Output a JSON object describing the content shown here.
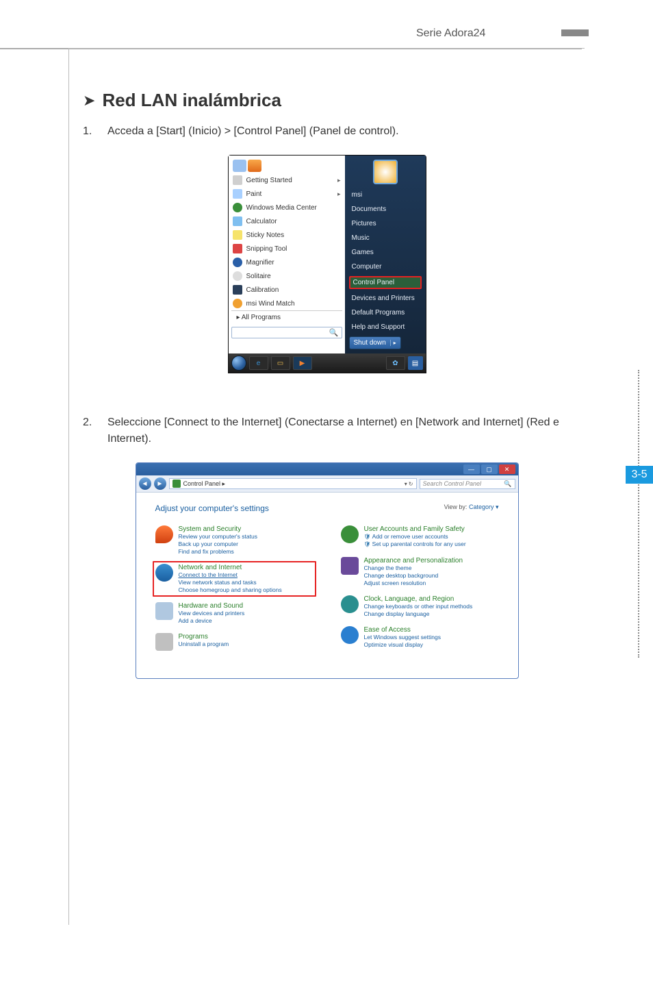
{
  "header": {
    "title": "Serie Adora24"
  },
  "section": {
    "heading": "Red LAN inalámbrica"
  },
  "steps": {
    "s1_num": "1.",
    "s1_text": "Acceda a [Start] (Inicio) > [Control Panel] (Panel de control).",
    "s2_num": "2.",
    "s2_text": "Seleccione [Connect to the Internet] (Conectarse a Internet) en [Network and Internet] (Red e Internet)."
  },
  "startmenu": {
    "programs": {
      "getting_started": "Getting Started",
      "paint": "Paint",
      "wmc": "Windows Media Center",
      "calculator": "Calculator",
      "sticky": "Sticky Notes",
      "snip": "Snipping Tool",
      "magnifier": "Magnifier",
      "solitaire": "Solitaire",
      "calibration": "Calibration",
      "windmatch": "msi Wind Match",
      "allprograms": "All Programs"
    },
    "right": {
      "user": "msi",
      "documents": "Documents",
      "pictures": "Pictures",
      "music": "Music",
      "games": "Games",
      "computer": "Computer",
      "controlpanel": "Control Panel",
      "devices": "Devices and Printers",
      "defaultprog": "Default Programs",
      "help": "Help and Support",
      "shutdown": "Shut down"
    },
    "search_placeholder": ""
  },
  "cpwin": {
    "titlebar": {
      "min": "—",
      "max": "▢",
      "close": "✕"
    },
    "breadcrumb": "Control Panel  ▸",
    "search_placeholder": "Search Control Panel",
    "heading": "Adjust your computer's settings",
    "viewby_label": "View by:",
    "viewby_value": "Category ▾",
    "left": {
      "sys": {
        "title": "System and Security",
        "l1": "Review your computer's status",
        "l2": "Back up your computer",
        "l3": "Find and fix problems"
      },
      "net": {
        "title": "Network and Internet",
        "l1": "Connect to the Internet",
        "l2": "View network status and tasks",
        "l3": "Choose homegroup and sharing options"
      },
      "hw": {
        "title": "Hardware and Sound",
        "l1": "View devices and printers",
        "l2": "Add a device"
      },
      "prog": {
        "title": "Programs",
        "l1": "Uninstall a program"
      }
    },
    "right": {
      "user": {
        "title": "User Accounts and Family Safety",
        "l1": "Add or remove user accounts",
        "l2": "Set up parental controls for any user"
      },
      "app": {
        "title": "Appearance and Personalization",
        "l1": "Change the theme",
        "l2": "Change desktop background",
        "l3": "Adjust screen resolution"
      },
      "clk": {
        "title": "Clock, Language, and Region",
        "l1": "Change keyboards or other input methods",
        "l2": "Change display language"
      },
      "ease": {
        "title": "Ease of Access",
        "l1": "Let Windows suggest settings",
        "l2": "Optimize visual display"
      }
    }
  },
  "page_number": "3-5"
}
